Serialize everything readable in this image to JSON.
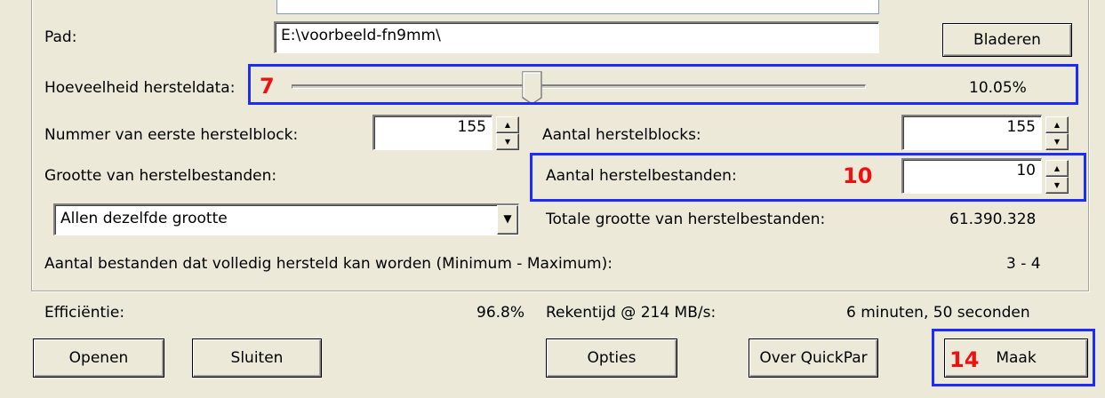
{
  "path": {
    "label": "Pad:",
    "value": "E:\\voorbeeld-fn9mm\\",
    "browse_label": "Bladeren"
  },
  "redundancy": {
    "label": "Hoeveelheid hersteldata:",
    "percent_text": "10.05%",
    "slider_fraction": 0.42
  },
  "first_block": {
    "label": "Nummer van eerste herstelblock:",
    "value": "155"
  },
  "block_count": {
    "label": "Aantal herstelblocks:",
    "value": "155"
  },
  "file_size": {
    "label": "Grootte van herstelbestanden:",
    "selected": "Allen dezelfde grootte"
  },
  "file_count": {
    "label": "Aantal herstelbestanden:",
    "value": "10"
  },
  "total_size": {
    "label": "Totale grootte van herstelbestanden:",
    "value": "61.390.328"
  },
  "recoverable": {
    "label": "Aantal bestanden dat volledig hersteld kan worden (Minimum - Maximum):",
    "value": "3 - 4"
  },
  "efficiency": {
    "label": "Efficiëntie:",
    "value": "96.8%"
  },
  "compute": {
    "label": "Rekentijd @ 214 MB/s:",
    "value": "6 minuten, 50 seconden"
  },
  "buttons": {
    "open": "Openen",
    "close": "Sluiten",
    "options": "Opties",
    "about": "Over QuickPar",
    "create": "Maak"
  },
  "annotations": {
    "slider_step": "7",
    "files_step": "10",
    "create_step": "14"
  },
  "colors": {
    "highlight": "#1e2bff",
    "step_number": "#ee1111",
    "background": "#ece9d8"
  },
  "icons": {
    "spin_up": "▲",
    "spin_down": "▼",
    "combo_arrow": "▼"
  }
}
